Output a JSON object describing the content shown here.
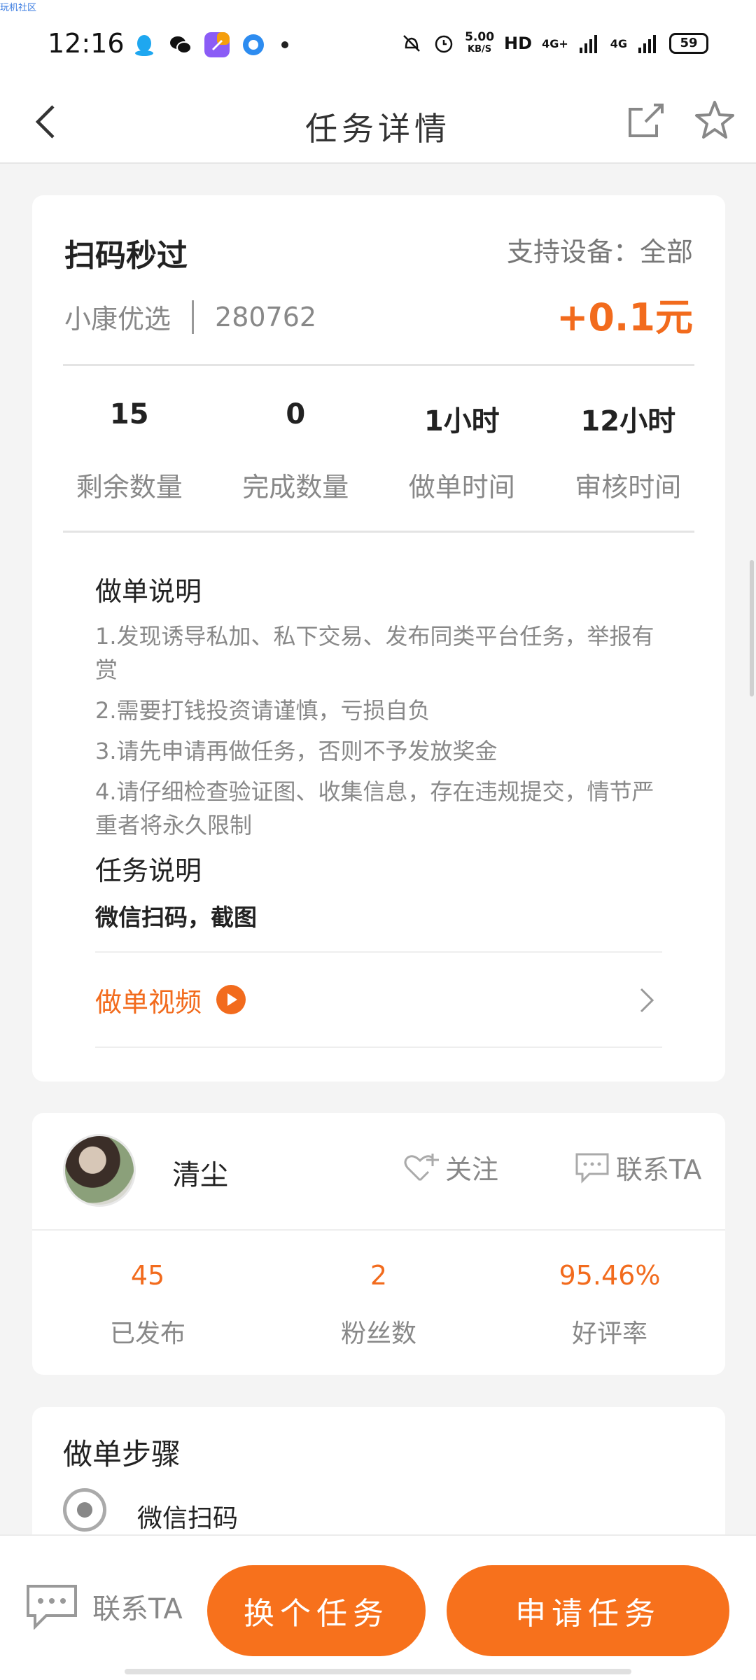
{
  "watermark": "玩机社区",
  "status_bar": {
    "time": "12:16",
    "net_speed_value": "5.00",
    "net_speed_unit": "KB/S",
    "hd": "HD",
    "sig1": "4G+",
    "sig2": "4G",
    "battery": "59"
  },
  "nav": {
    "title": "任务详情"
  },
  "task": {
    "title": "扫码秒过",
    "device": "支持设备：全部",
    "merchant": "小康优选",
    "task_id": "280762",
    "reward": "+0.1元",
    "stats": [
      {
        "value": "15",
        "label": "剩余数量"
      },
      {
        "value": "0",
        "label": "完成数量"
      },
      {
        "value": "1小时",
        "label": "做单时间"
      },
      {
        "value": "12小时",
        "label": "审核时间"
      }
    ],
    "notes_heading": "做单说明",
    "notes": [
      "1.发现诱导私加、私下交易、发布同类平台任务，举报有赏",
      "2.需要打钱投资请谨慎，亏损自负",
      "3.请先申请再做任务，否则不予发放奖金",
      "4.请仔细检查验证图、收集信息，存在违规提交，情节严重者将永久限制"
    ],
    "task_desc_heading": "任务说明",
    "task_desc": "微信扫码，截图",
    "video_label": "做单视频"
  },
  "publisher": {
    "name": "清尘",
    "follow": "关注",
    "contact": "联系TA",
    "stats": [
      {
        "value": "45",
        "label": "已发布"
      },
      {
        "value": "2",
        "label": "粉丝数"
      },
      {
        "value": "95.46%",
        "label": "好评率"
      }
    ]
  },
  "steps": {
    "heading": "做单步骤",
    "items": [
      "微信扫码"
    ]
  },
  "bottom": {
    "contact": "联系TA",
    "switch_btn": "换个任务",
    "apply_btn": "申请任务"
  },
  "colors": {
    "accent": "#f7711c",
    "reward": "#f26b1d"
  }
}
